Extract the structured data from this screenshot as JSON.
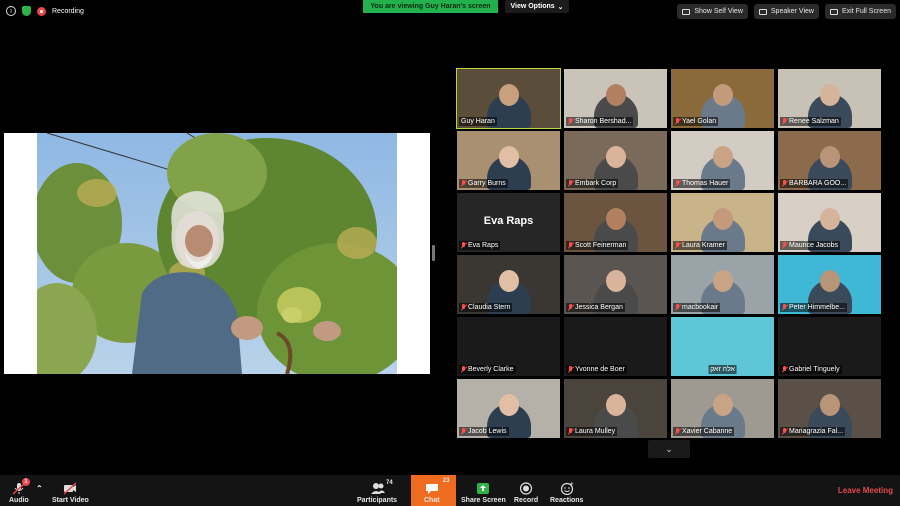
{
  "status": {
    "recording_label": "Recording"
  },
  "banner": {
    "viewing_text": "You are viewing Guy Haran's screen",
    "view_options_label": "View Options"
  },
  "top_right": {
    "show_self_view": "Show Self View",
    "speaker_view": "Speaker View",
    "exit_full_screen": "Exit Full Screen"
  },
  "colors": {
    "banner_green": "#23b14d",
    "active_border": "#b9d441",
    "chat_orange": "#ef6b20",
    "leave_red": "#e8484b",
    "muted_red": "#ff4d4d"
  },
  "participants": [
    {
      "name": "Guy Haran",
      "muted": false,
      "active": true
    },
    {
      "name": "Sharon Bershad...",
      "muted": true
    },
    {
      "name": "Yael Golan",
      "muted": true
    },
    {
      "name": "Renee Salzman",
      "muted": true
    },
    {
      "name": "Garry Burns",
      "muted": true
    },
    {
      "name": "Embark Corp",
      "muted": true
    },
    {
      "name": "Thomas Hauer",
      "muted": true
    },
    {
      "name": "BARBARA GOO...",
      "muted": true
    },
    {
      "name": "Eva Raps",
      "muted": true,
      "video_off": true
    },
    {
      "name": "Scott Feinerman",
      "muted": true
    },
    {
      "name": "Laura Kramer",
      "muted": true
    },
    {
      "name": "Maurice Jacobs",
      "muted": true
    },
    {
      "name": "Claudia Stern",
      "muted": true
    },
    {
      "name": "Jessica Bergan",
      "muted": true
    },
    {
      "name": "macbookair",
      "muted": true
    },
    {
      "name": "Peter Himmelbe...",
      "muted": true
    },
    {
      "name": "Beverly Clarke",
      "muted": true,
      "video_off": true
    },
    {
      "name": "Yvonne de Boer",
      "muted": true,
      "video_off": true
    },
    {
      "name": "אלה זאק",
      "muted": false,
      "video_on": true
    },
    {
      "name": "Gabriel Tinguely",
      "muted": true,
      "video_off": true
    },
    {
      "name": "Jacob Lewis",
      "muted": true
    },
    {
      "name": "Laura Mulley",
      "muted": true
    },
    {
      "name": "Xavier Cabanne",
      "muted": true
    },
    {
      "name": "Mariagrazia Fal...",
      "muted": true
    }
  ],
  "toolbar": {
    "audio": "Audio",
    "audio_badge": "1",
    "start_video": "Start Video",
    "participants": "Participants",
    "participants_count": "74",
    "chat": "Chat",
    "chat_count": "23",
    "share_screen": "Share Screen",
    "record": "Record",
    "reactions": "Reactions",
    "leave_meeting": "Leave Meeting"
  },
  "icons": [
    "info-icon",
    "shield-icon",
    "record-icon",
    "chevron-down-icon",
    "mic-muted-icon",
    "video-off-icon",
    "people-icon",
    "chat-icon",
    "share-screen-icon",
    "record-button-icon",
    "reaction-icon"
  ]
}
